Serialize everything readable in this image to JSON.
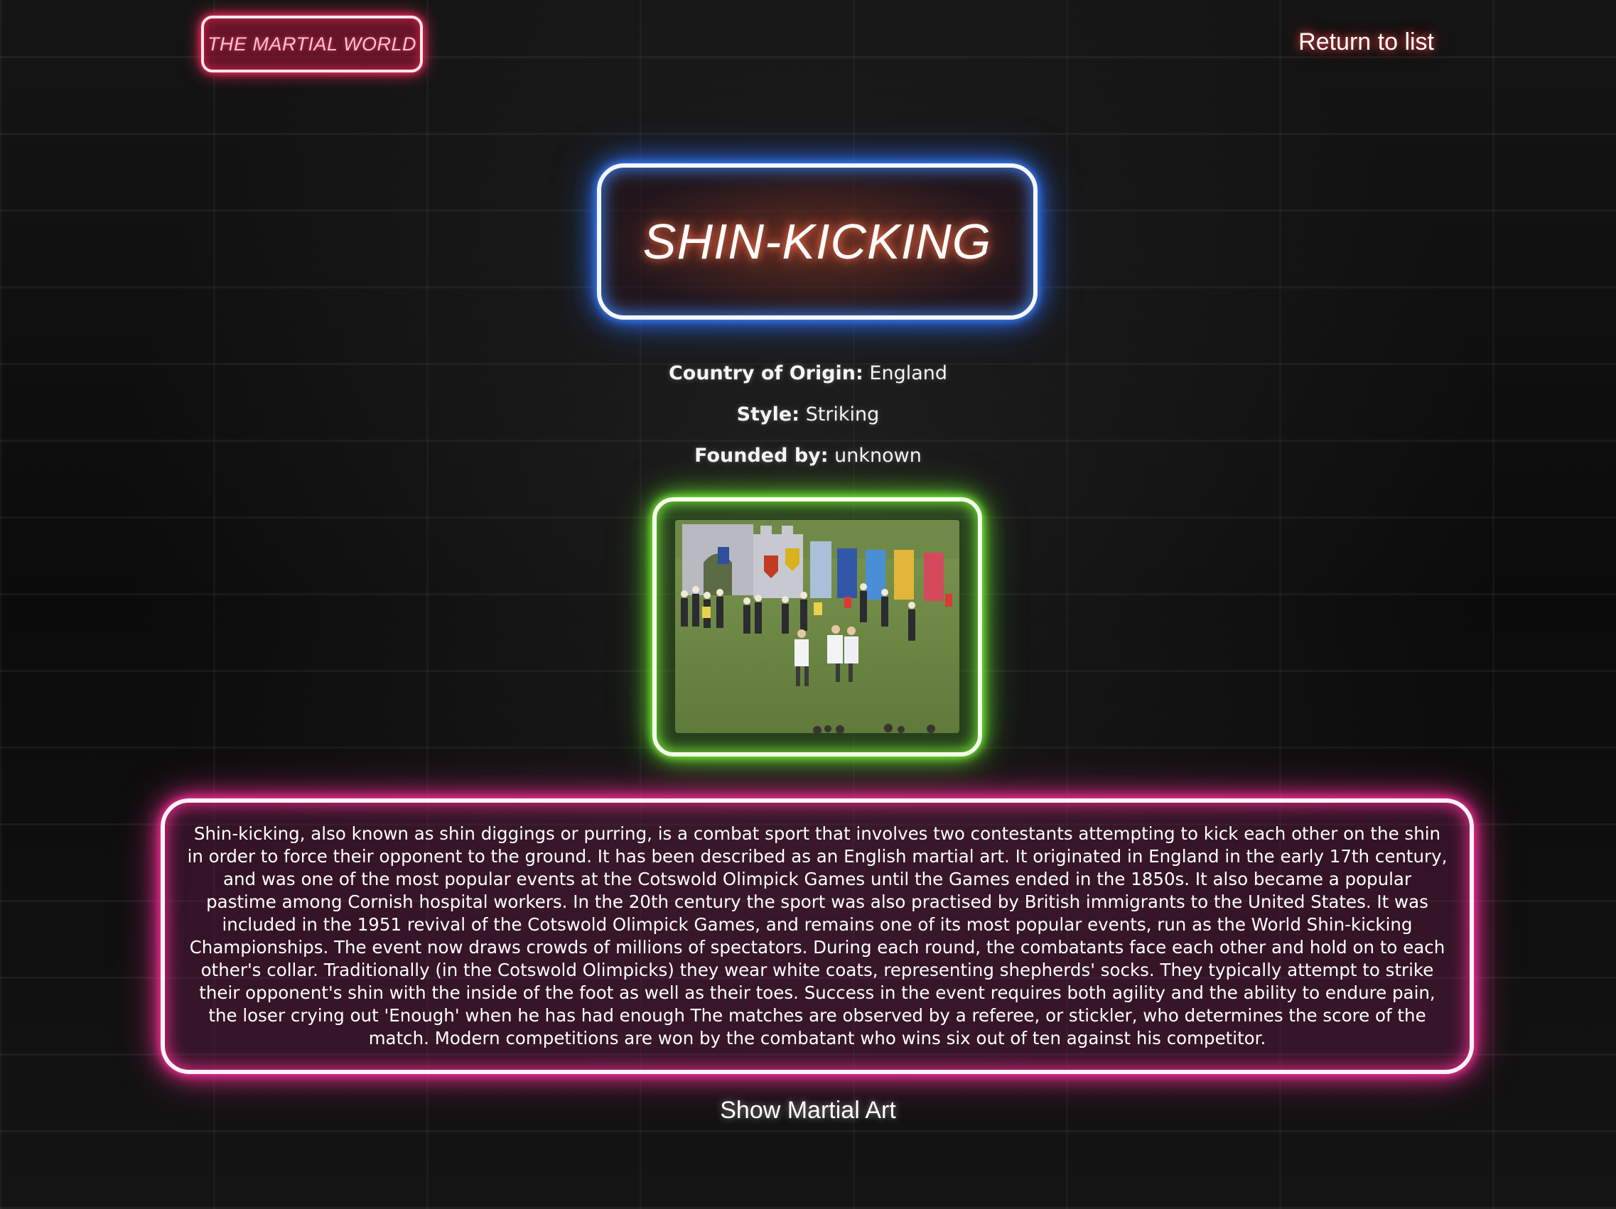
{
  "header": {
    "brand_label": "THE MARTIAL WORLD",
    "return_label": "Return to list"
  },
  "martial_art": {
    "name": "SHIN-KICKING",
    "country_label": "Country of Origin:",
    "country_value": "England",
    "style_label": "Style:",
    "style_value": "Striking",
    "founded_label": "Founded by:",
    "founded_value": "unknown",
    "description": "Shin-kicking, also known as shin diggings or purring, is a combat sport that involves two contestants attempting to kick each other on the shin in order to force their opponent to the ground. It has been described as an English martial art. It originated in England in the early 17th century, and was one of the most popular events at the Cotswold Olimpick Games until the Games ended in the 1850s. It also became a popular pastime among Cornish hospital workers. In the 20th century the sport was also practised by British immigrants to the United States. It was included in the 1951 revival of the Cotswold Olimpick Games, and remains one of its most popular events, run as the World Shin-kicking Championships. The event now draws crowds of millions of spectators. During each round, the combatants face each other and hold on to each other's collar. Traditionally (in the Cotswold Olimpicks) they wear white coats, representing shepherds' socks. They typically attempt to strike their opponent's shin with the inside of the foot as well as their toes. Success in the event requires both agility and the ability to endure pain, the loser crying out 'Enough' when he has had enough The matches are observed by a referee, or stickler, who determines the score of the match. Modern competitions are won by the combatant who wins six out of ten against his competitor."
  },
  "footer": {
    "show_label": "Show Martial Art"
  },
  "colors": {
    "brand_glow": "#ff2a5a",
    "title_glow": "#2f6fff",
    "photo_glow": "#6ae52f",
    "description_glow": "#ff2f9a"
  }
}
